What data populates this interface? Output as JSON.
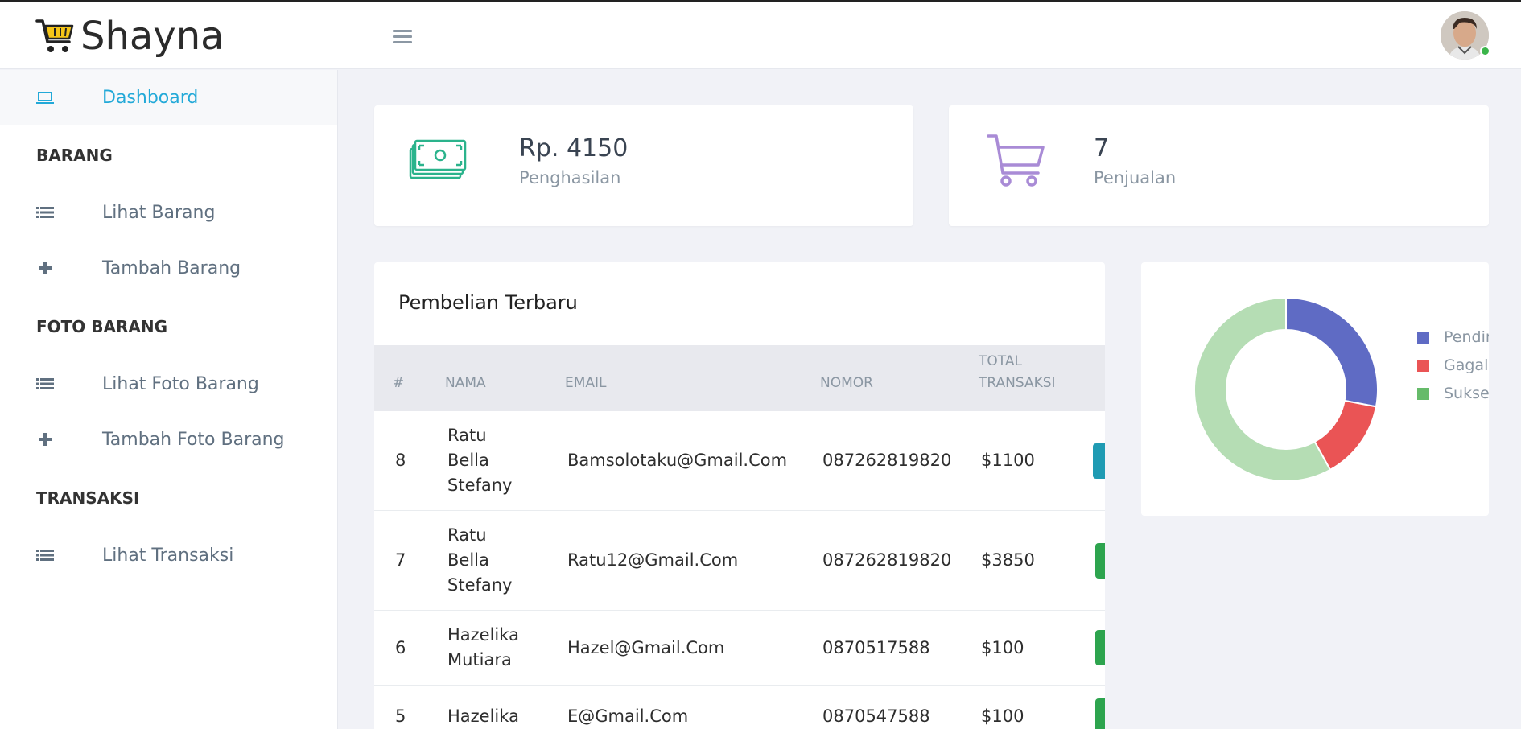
{
  "app": {
    "brand": "Shayna"
  },
  "sidebar": {
    "dashboard": {
      "label": "Dashboard"
    },
    "sections": [
      {
        "title": "BARANG",
        "items": [
          {
            "label": "Lihat Barang",
            "icon": "list-icon"
          },
          {
            "label": "Tambah Barang",
            "icon": "plus-icon"
          }
        ]
      },
      {
        "title": "FOTO BARANG",
        "items": [
          {
            "label": "Lihat Foto Barang",
            "icon": "list-icon"
          },
          {
            "label": "Tambah Foto Barang",
            "icon": "plus-icon"
          }
        ]
      },
      {
        "title": "TRANSAKSI",
        "items": [
          {
            "label": "Lihat Transaksi",
            "icon": "list-icon"
          }
        ]
      }
    ]
  },
  "stats": {
    "income": {
      "value": "Rp. 4150",
      "label": "Penghasilan",
      "icon": "money-icon",
      "color": "#2bb38c"
    },
    "sales": {
      "value": "7",
      "label": "Penjualan",
      "icon": "cart-icon",
      "color": "#a98bd6"
    }
  },
  "purchases": {
    "title": "Pembelian Terbaru",
    "columns": {
      "id": "#",
      "name": "NAMA",
      "email": "EMAIL",
      "phone": "NOMOR",
      "total_line1": "TOTAL",
      "total_line2": "TRANSAKSI"
    },
    "rows": [
      {
        "id": "8",
        "name_lines": [
          "Ratu",
          "Bella",
          "Stefany"
        ],
        "email": "Bamsolotaku@Gmail.Com",
        "phone": "087262819820",
        "total": "$1100",
        "status_color": "#1f9bb3"
      },
      {
        "id": "7",
        "name_lines": [
          "Ratu",
          "Bella",
          "Stefany"
        ],
        "email": "Ratu12@Gmail.Com",
        "phone": "087262819820",
        "total": "$3850",
        "status_color": "#2da44e"
      },
      {
        "id": "6",
        "name_lines": [
          "Hazelika",
          "Mutiara"
        ],
        "email": "Hazel@Gmail.Com",
        "phone": "0870517588",
        "total": "$100",
        "status_color": "#2da44e"
      },
      {
        "id": "5",
        "name_lines": [
          "Hazelika"
        ],
        "email": "E@Gmail.Com",
        "phone": "0870547588",
        "total": "$100",
        "status_color": "#2da44e"
      }
    ]
  },
  "chart_data": {
    "type": "pie",
    "title": "",
    "labels": [
      "Pending",
      "Gagal",
      "Sukses"
    ],
    "legend_visible_labels": [
      "Pendin",
      "Gagal",
      "Sukses"
    ],
    "values": [
      28,
      14,
      58
    ],
    "colors": [
      "#5f6bc4",
      "#ea5455",
      "#b5ddb4"
    ],
    "legend_colors": [
      "#5f6bc4",
      "#ea5455",
      "#66bb6a"
    ],
    "legend_position": "right"
  }
}
